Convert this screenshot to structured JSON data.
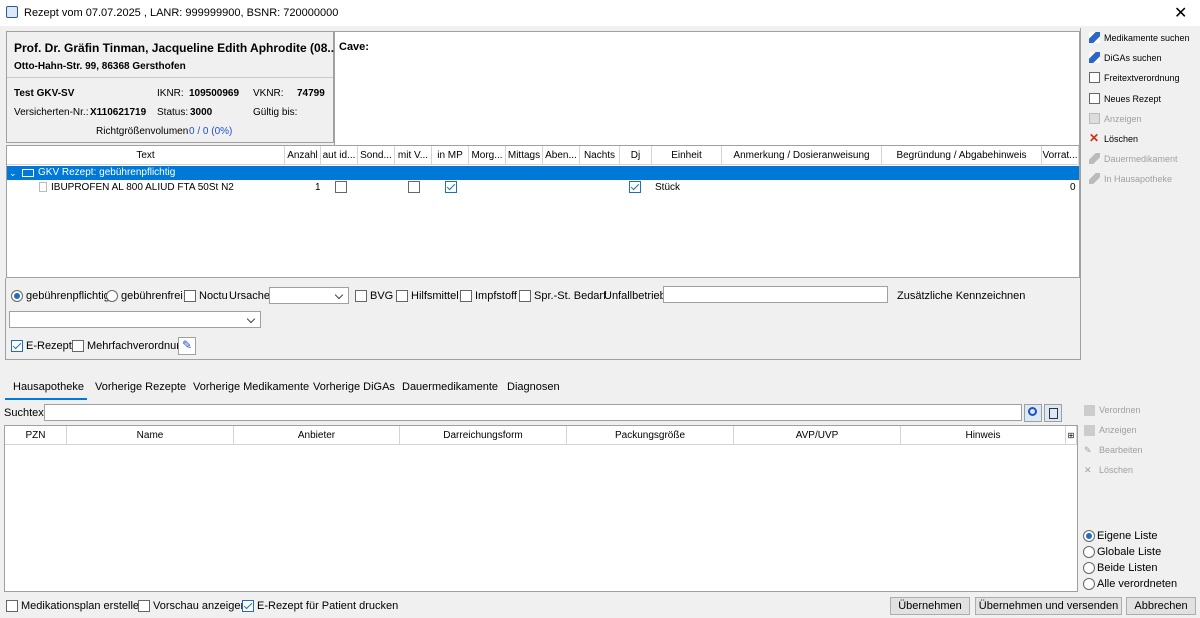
{
  "window": {
    "title": "Rezept vom 07.07.2025 , LANR: 999999900, BSNR: 720000000"
  },
  "patient": {
    "name": "Prof. Dr. Gräfin Tinman, Jacqueline Edith Aphrodite (08....",
    "address": "Otto-Hahn-Str. 99, 86368 Gersthofen",
    "insurance": "Test GKV-SV",
    "iknr_label": "IKNR:",
    "iknr": "109500969",
    "vknr_label": "VKNR:",
    "vknr": "74799",
    "versnr_label": "Versicherten-Nr.:",
    "versnr": "X110621719",
    "status_label": "Status:",
    "status": "3000",
    "gueltig_label": "Gültig bis:",
    "richtgroessen_label": "Richtgrößenvolumen",
    "richtgroessen_value": "0 / 0 (0%)"
  },
  "cave": {
    "label": "Cave:"
  },
  "grid": {
    "columns": [
      "Text",
      "Anzahl",
      "aut id...",
      "Sond...",
      "mit V...",
      "in MP",
      "Morg...",
      "Mittags",
      "Aben...",
      "Nachts",
      "Dj",
      "Einheit",
      "Anmerkung / Dosieranweisung",
      "Begründung / Abgabehinweis",
      "Vorrat..."
    ],
    "group": "GKV Rezept: gebührenpflichtig",
    "row": {
      "name": "IBUPROFEN AL 800 ALIUD FTA 50St N2",
      "anzahl": "1",
      "einheit": "Stück",
      "vorrat": "0"
    }
  },
  "options": {
    "gebuehrenpflichtig": "gebührenpflichtig",
    "gebuehrenfrei": "gebührenfrei",
    "noctu": "Noctu",
    "ursache": "Ursache",
    "bvg": "BVG",
    "hilfsmittel": "Hilfsmittel",
    "impfstoff": "Impfstoff",
    "sprst": "Spr.-St. Bedarf",
    "unfallbetrieb": "Unfallbetrieb",
    "zusatz": "Zusätzliche Kennzeichnen",
    "erezept": "E-Rezept",
    "mehrfach": "Mehrfachverordnung"
  },
  "side_buttons": [
    {
      "label": "Medikamente suchen",
      "enabled": true
    },
    {
      "label": "DiGAs suchen",
      "enabled": true
    },
    {
      "label": "Freitextverordnung",
      "enabled": true
    },
    {
      "label": "Neues Rezept",
      "enabled": true
    },
    {
      "label": "Anzeigen",
      "enabled": false
    },
    {
      "label": "Löschen",
      "enabled": true
    },
    {
      "label": "Dauermedikament",
      "enabled": false
    },
    {
      "label": "In Hausapotheke",
      "enabled": false
    }
  ],
  "tabs": [
    "Hausapotheke",
    "Vorherige Rezepte",
    "Vorherige Medikamente",
    "Vorherige DiGAs",
    "Dauermedikamente",
    "Diagnosen"
  ],
  "search": {
    "label": "Suchtext:",
    "value": ""
  },
  "lower_table": {
    "columns": [
      "PZN",
      "Name",
      "Anbieter",
      "Darreichungsform",
      "Packungsgröße",
      "AVP/UVP",
      "Hinweis"
    ]
  },
  "lower_buttons": [
    "Verordnen",
    "Anzeigen",
    "Bearbeiten",
    "Löschen"
  ],
  "list_options": [
    "Eigene Liste",
    "Globale Liste",
    "Beide Listen",
    "Alle verordneten"
  ],
  "footer": {
    "medplan": "Medikationsplan erstellen",
    "vorschau": "Vorschau anzeigen",
    "erezept_druck": "E-Rezept für Patient drucken",
    "uebernehmen": "Übernehmen",
    "uebernehmen_senden": "Übernehmen und versenden",
    "abbrechen": "Abbrechen"
  },
  "colors": {
    "accent": "#0078d7",
    "link": "#1f50c8"
  }
}
